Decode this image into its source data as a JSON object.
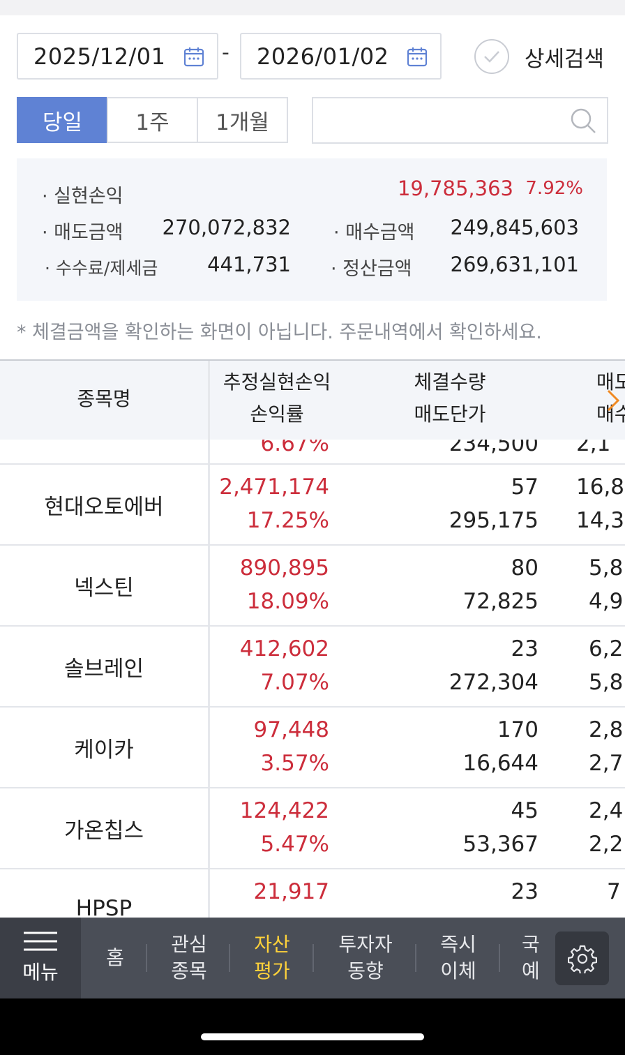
{
  "filter": {
    "start_date": "2025/12/01",
    "end_date": "2026/01/02",
    "date_separator": "-",
    "detail_search_label": "상세검색",
    "periods": [
      "당일",
      "1주",
      "1개월"
    ],
    "active_period": "당일",
    "search_placeholder": ""
  },
  "summary": {
    "realized_pl_label": "· 실현손익",
    "realized_pl_value": "19,785,363",
    "realized_pl_rate": "7.92%",
    "sell_amount_label": "· 매도금액",
    "sell_amount_value": "270,072,832",
    "buy_amount_label": "· 매수금액",
    "buy_amount_value": "249,845,603",
    "fee_tax_label": "· 수수료/제세금",
    "fee_tax_value": "441,731",
    "settlement_label": "· 정산금액",
    "settlement_value": "269,631,101"
  },
  "notice": "* 체결금액을 확인하는 화면이 아닙니다. 주문내역에서 확인하세요.",
  "table": {
    "headers": {
      "name": "종목명",
      "pl_top": "추정실현손익",
      "pl_bottom": "손익률",
      "qty_top": "체결수량",
      "qty_bottom": "매도단가",
      "amt_top": "매도",
      "amt_bottom": "매수"
    },
    "partial_row": {
      "pl_rate": "6.67%",
      "sell_price": "234,500",
      "buy_amt": "2,1"
    },
    "rows": [
      {
        "name": "현대오토에버",
        "pl": "2,471,174",
        "rate": "17.25%",
        "qty": "57",
        "price": "295,175",
        "sell_amt": "16,8",
        "buy_amt": "14,3"
      },
      {
        "name": "넥스틴",
        "pl": "890,895",
        "rate": "18.09%",
        "qty": "80",
        "price": "72,825",
        "sell_amt": "5,8",
        "buy_amt": "4,9"
      },
      {
        "name": "솔브레인",
        "pl": "412,602",
        "rate": "7.07%",
        "qty": "23",
        "price": "272,304",
        "sell_amt": "6,2",
        "buy_amt": "5,8"
      },
      {
        "name": "케이카",
        "pl": "97,448",
        "rate": "3.57%",
        "qty": "170",
        "price": "16,644",
        "sell_amt": "2,8",
        "buy_amt": "2,7"
      },
      {
        "name": "가온칩스",
        "pl": "124,422",
        "rate": "5.47%",
        "qty": "45",
        "price": "53,367",
        "sell_amt": "2,4",
        "buy_amt": "2,2"
      },
      {
        "name": "HPSP",
        "pl": "21,917",
        "rate": "",
        "qty": "23",
        "price": "",
        "sell_amt": "7",
        "buy_amt": ""
      }
    ]
  },
  "bottom_nav": {
    "menu_label": "메뉴",
    "items": [
      {
        "line1": "홈",
        "line2": ""
      },
      {
        "line1": "관심",
        "line2": "종목"
      },
      {
        "line1": "자산",
        "line2": "평가"
      },
      {
        "line1": "투자자",
        "line2": "동향"
      },
      {
        "line1": "즉시",
        "line2": "이체"
      },
      {
        "line1": "국",
        "line2": "예"
      }
    ],
    "active_index": 2
  },
  "colors": {
    "accent": "#5f82d4",
    "profit": "#cc2d3b",
    "nav_active": "#ffd23a",
    "nav_bg": "#4a4e57"
  }
}
